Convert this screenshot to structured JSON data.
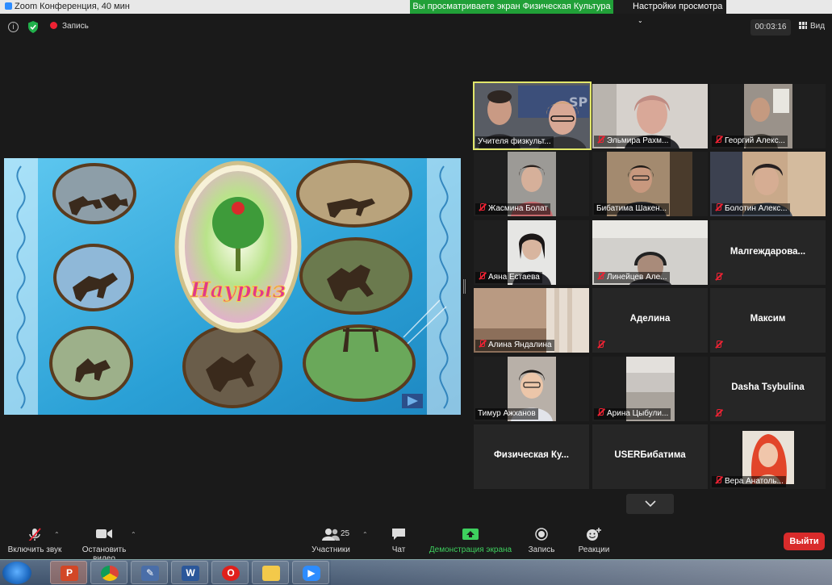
{
  "titlebar": {
    "app_title": "Zoom Конференция, 40 мин",
    "share_banner": "Вы просматриваете экран Физическая Культура",
    "view_options": "Настройки просмотра"
  },
  "meeting_bar": {
    "recording_label": "Запись",
    "timer": "00:03:16",
    "view_label": "Вид"
  },
  "shared_screen": {
    "slide_title": "Наурыз"
  },
  "participants": [
    {
      "name": "Учителя физкульт...",
      "muted": false,
      "active": true
    },
    {
      "name": "Эльмира Рахм...",
      "muted": true
    },
    {
      "name": "Георгий Алекс...",
      "muted": true
    },
    {
      "name": "Жасмина Болат",
      "muted": true
    },
    {
      "name": "Бибатима Шакен...",
      "muted": false
    },
    {
      "name": "Болотин Алекс...",
      "muted": true
    },
    {
      "name": "Аяна Естаева",
      "muted": true
    },
    {
      "name": "Линейцев Але...",
      "muted": true
    },
    {
      "name": "Малгеждарова...",
      "muted": true
    },
    {
      "name": "Алина Яндалина",
      "muted": true
    },
    {
      "name": "Аделина",
      "muted": true
    },
    {
      "name": "Максим",
      "muted": true
    },
    {
      "name": "Тимур Ажханов",
      "muted": false
    },
    {
      "name": "Арина Цыбули...",
      "muted": true
    },
    {
      "name": "Dasha Tsybulina",
      "muted": true
    },
    {
      "name": "Физическая  Ку...",
      "muted": false
    },
    {
      "name": "USERБибатима",
      "muted": false
    },
    {
      "name": "Вера Анатоль...",
      "muted": true
    }
  ],
  "toolbar": {
    "unmute_label": "Включить звук",
    "stop_video_label": "Остановить видео",
    "participants_label": "Участники",
    "participants_count": "25",
    "chat_label": "Чат",
    "share_screen_label": "Демонстрация экрана",
    "record_label": "Запись",
    "reactions_label": "Реакции",
    "leave_label": "Выйти"
  },
  "colors": {
    "share_green": "#21a038",
    "active_speaker": "#e1e66a",
    "leave_red": "#d92b2b",
    "tile_bg": "#262626"
  }
}
